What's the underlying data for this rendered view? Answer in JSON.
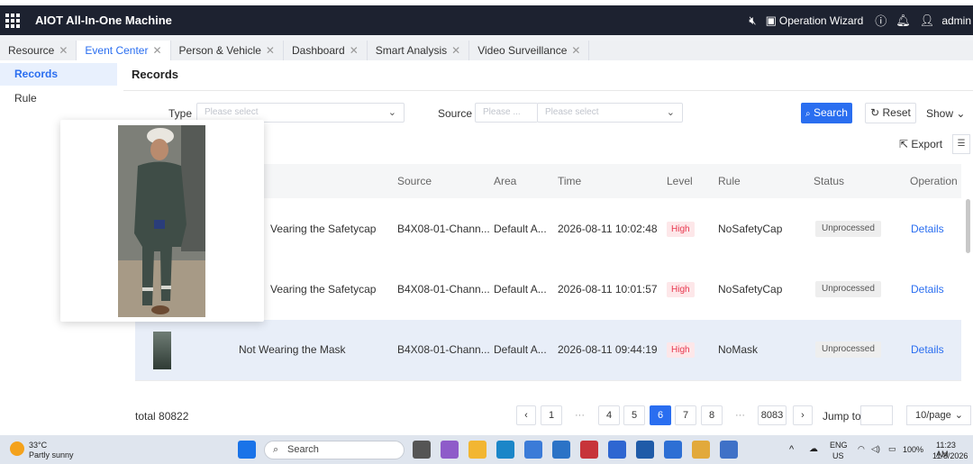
{
  "app": {
    "title": "AIOT All-In-One Machine",
    "operation_wizard": "Operation Wizard",
    "user": "admin"
  },
  "tabs": [
    {
      "label": "Resource"
    },
    {
      "label": "Event Center"
    },
    {
      "label": "Person & Vehicle"
    },
    {
      "label": "Dashboard"
    },
    {
      "label": "Smart Analysis"
    },
    {
      "label": "Video Surveillance"
    }
  ],
  "sidebar": {
    "items": [
      {
        "label": "Records"
      },
      {
        "label": "Rule"
      }
    ]
  },
  "page": {
    "title": "Records"
  },
  "filters": {
    "type_label": "Type",
    "type_placeholder": "Please select",
    "source_label": "Source",
    "source_placeholder_1": "Please ...",
    "source_placeholder_2": "Please select",
    "search_label": "Search",
    "reset_label": "Reset",
    "show_label": "Show"
  },
  "toolbar": {
    "export_label": "Export"
  },
  "table": {
    "headers": [
      "Source",
      "Area",
      "Time",
      "Level",
      "Rule",
      "Status",
      "Operation"
    ],
    "rows": [
      {
        "event": "Vearing the Safetycap",
        "source": "B4X08-01-Chann...",
        "area": "Default A...",
        "time": "2026-08-11 10:02:48",
        "level": "High",
        "rule": "NoSafetyCap",
        "status": "Unprocessed",
        "op": "Details"
      },
      {
        "event": "Vearing the Safetycap",
        "source": "B4X08-01-Chann...",
        "area": "Default A...",
        "time": "2026-08-11 10:01:57",
        "level": "High",
        "rule": "NoSafetyCap",
        "status": "Unprocessed",
        "op": "Details"
      },
      {
        "event": "Not Wearing the Mask",
        "source": "B4X08-01-Chann...",
        "area": "Default A...",
        "time": "2026-08-11 09:44:19",
        "level": "High",
        "rule": "NoMask",
        "status": "Unprocessed",
        "op": "Details"
      }
    ]
  },
  "pagination": {
    "total": "total 80822",
    "pages": [
      "1",
      "4",
      "5",
      "6",
      "7",
      "8",
      "8083"
    ],
    "dots": "···",
    "jump_label": "Jump to",
    "per_page": "10/page"
  },
  "taskbar": {
    "temperature": "33°C",
    "weather": "Partly sunny",
    "search_label": "Search",
    "lang": "ENG",
    "region": "US",
    "battery": "100%",
    "time": "11:23 AM",
    "date": "11/8/2026"
  },
  "colors": {
    "accent": "#2a6ef0",
    "header_bg": "#1d2230",
    "high": "#e8384f"
  }
}
